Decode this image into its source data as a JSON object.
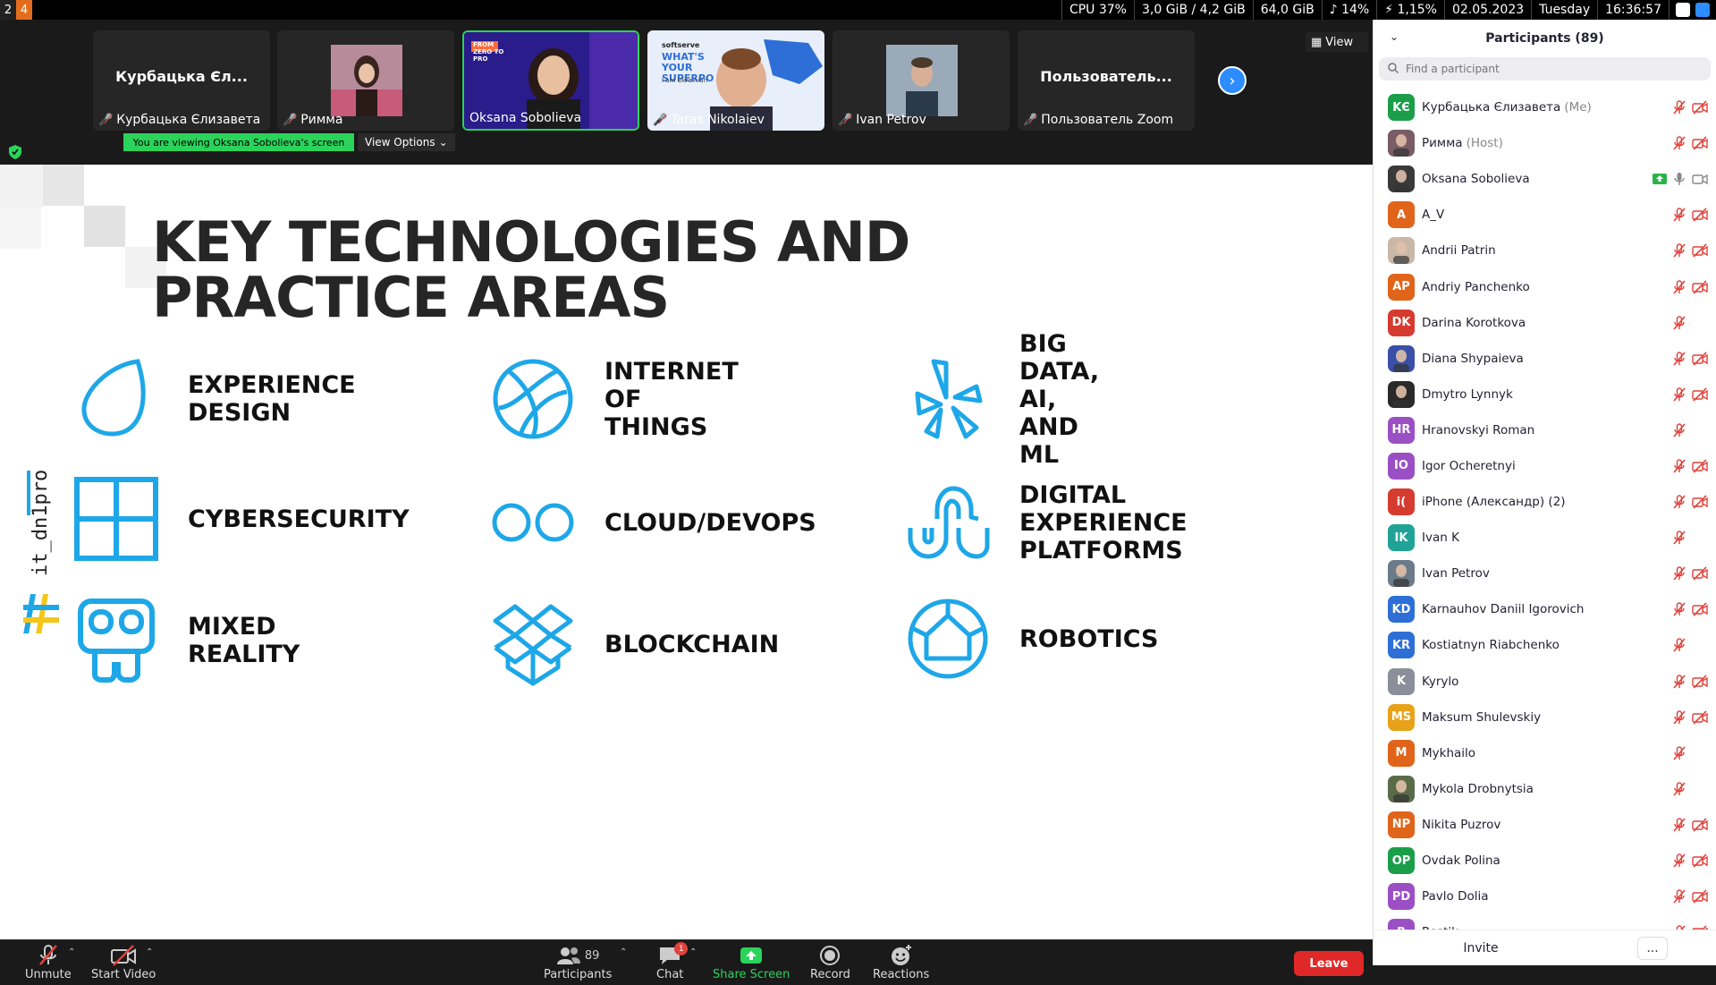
{
  "system_bar": {
    "workspaces": [
      "2",
      "4"
    ],
    "cpu": "CPU 37%",
    "mem": "3,0 GiB / 4,2 GiB",
    "disk": "64,0 GiB",
    "volume": "♪ 14%",
    "battery": "⚡ 1,15%",
    "date": "02.05.2023",
    "weekday": "Tuesday",
    "time": "16:36:57"
  },
  "thumbnails": [
    {
      "big_name": "Курбацька Єл...",
      "label": "Курбацька Єлизавета",
      "muted": true
    },
    {
      "big_name": "",
      "label": "Римма",
      "muted": true
    },
    {
      "big_name": "",
      "label": "Oksana Sobolieva",
      "muted": false,
      "active": true
    },
    {
      "big_name": "",
      "label": "Taras Nikolaiev",
      "muted": true
    },
    {
      "big_name": "",
      "label": "Ivan Petrov",
      "muted": true
    },
    {
      "big_name": "Пользователь...",
      "label": "Пользователь Zoom",
      "muted": true
    }
  ],
  "thumb_inner": {
    "oksana_slide_text": "FROM ZERO TO PRO",
    "taras_slide_text": "WHAT'S YOUR SUPERPO",
    "taras_brand": "softserve",
    "taras_sub": "I am Ukrainian"
  },
  "view_button": "View",
  "viewing_banner": "You are viewing Oksana Sobolieva's screen",
  "view_options": "View Options",
  "slide": {
    "title": "KEY TECHNOLOGIES AND PRACTICE AREAS",
    "brand": "it_dn1pro",
    "tiles": [
      {
        "label": "EXPERIENCE\nDESIGN",
        "icon": "envato-leaf-icon"
      },
      {
        "label": "INTERNET OF\nTHINGS",
        "icon": "basketball-icon"
      },
      {
        "label": "BIG DATA, AI,\nAND ML",
        "icon": "yelp-star-icon"
      },
      {
        "label": "CYBERSECURITY",
        "icon": "windows-grid-icon"
      },
      {
        "label": "CLOUD/DEVOPS",
        "icon": "flickr-dots-icon"
      },
      {
        "label": "DIGITAL\nEXPERIENCE\nPLATFORMS",
        "icon": "stumbleupon-icon"
      },
      {
        "label": "MIXED REALITY",
        "icon": "instructables-robot-icon"
      },
      {
        "label": "BLOCKCHAIN",
        "icon": "dropbox-box-icon"
      },
      {
        "label": "ROBOTICS",
        "icon": "house-circle-icon"
      }
    ],
    "accent": "#1ea7e8"
  },
  "toolbar": {
    "unmute": "Unmute",
    "start_video": "Start Video",
    "participants": "Participants",
    "participants_count": "89",
    "chat": "Chat",
    "chat_badge": "1",
    "share_screen": "Share Screen",
    "record": "Record",
    "reactions": "Reactions",
    "leave": "Leave"
  },
  "panel": {
    "title": "Participants (89)",
    "search_placeholder": "Find a participant",
    "invite": "Invite",
    "more": "...",
    "participants": [
      {
        "name": "Курбацька Єлизавета",
        "role": "(Me)",
        "initials": "KЄ",
        "color": "#1a9e4a",
        "photo": false,
        "audio": "muted",
        "video": "off"
      },
      {
        "name": "Римма",
        "role": "(Host)",
        "initials": "",
        "color": "#7a5c66",
        "photo": true,
        "audio": "muted",
        "video": "off"
      },
      {
        "name": "Oksana Sobolieva",
        "role": "",
        "initials": "",
        "color": "#3a3a3a",
        "photo": true,
        "audio": "on",
        "video": "on",
        "sharing": true
      },
      {
        "name": "A_V",
        "role": "",
        "initials": "A",
        "color": "#e0641a",
        "photo": false,
        "audio": "muted",
        "video": "off"
      },
      {
        "name": "Andrii Patrin",
        "role": "",
        "initials": "",
        "color": "#c9b8a8",
        "photo": true,
        "audio": "muted",
        "video": "off"
      },
      {
        "name": "Andriy Panchenko",
        "role": "",
        "initials": "AP",
        "color": "#e0641a",
        "photo": false,
        "audio": "muted",
        "video": "off"
      },
      {
        "name": "Darina Korotkova",
        "role": "",
        "initials": "DK",
        "color": "#d63b2f",
        "photo": false,
        "audio": "muted",
        "video": "none"
      },
      {
        "name": "Diana Shypaieva",
        "role": "",
        "initials": "",
        "color": "#3a50a8",
        "photo": true,
        "audio": "muted",
        "video": "off"
      },
      {
        "name": "Dmytro Lynnyk",
        "role": "",
        "initials": "",
        "color": "#2a2a2a",
        "photo": true,
        "audio": "muted",
        "video": "off"
      },
      {
        "name": "Hranovskyi Roman",
        "role": "",
        "initials": "HR",
        "color": "#9b4fc4",
        "photo": false,
        "audio": "muted",
        "video": "none"
      },
      {
        "name": "Igor Ocheretnyi",
        "role": "",
        "initials": "IO",
        "color": "#9b4fc4",
        "photo": false,
        "audio": "muted",
        "video": "off"
      },
      {
        "name": "iPhone (Александр) (2)",
        "role": "",
        "initials": "i(",
        "color": "#d63b2f",
        "photo": false,
        "audio": "muted",
        "video": "off"
      },
      {
        "name": "Ivan K",
        "role": "",
        "initials": "IK",
        "color": "#1fa396",
        "photo": false,
        "audio": "muted",
        "video": "none"
      },
      {
        "name": "Ivan Petrov",
        "role": "",
        "initials": "",
        "color": "#6b7b8a",
        "photo": true,
        "audio": "muted",
        "video": "off"
      },
      {
        "name": "Karnauhov Daniil Igorovich",
        "role": "",
        "initials": "KD",
        "color": "#2d6fd6",
        "photo": false,
        "audio": "muted",
        "video": "off"
      },
      {
        "name": "Kostiatnyn Riabchenko",
        "role": "",
        "initials": "KR",
        "color": "#2d6fd6",
        "photo": false,
        "audio": "muted",
        "video": "none"
      },
      {
        "name": "Kyrylo",
        "role": "",
        "initials": "K",
        "color": "#8a8f99",
        "photo": false,
        "audio": "muted",
        "video": "off"
      },
      {
        "name": "Maksum Shulevskiy",
        "role": "",
        "initials": "MS",
        "color": "#e8a21a",
        "photo": false,
        "audio": "muted",
        "video": "off"
      },
      {
        "name": "Mykhailo",
        "role": "",
        "initials": "M",
        "color": "#e0641a",
        "photo": false,
        "audio": "muted",
        "video": "none"
      },
      {
        "name": "Mykola Drobnytsia",
        "role": "",
        "initials": "",
        "color": "#5a6b4a",
        "photo": true,
        "audio": "muted",
        "video": "none"
      },
      {
        "name": "Nikita Puzrov",
        "role": "",
        "initials": "NP",
        "color": "#e0641a",
        "photo": false,
        "audio": "muted",
        "video": "off"
      },
      {
        "name": "Ovdak Polina",
        "role": "",
        "initials": "OP",
        "color": "#1a9e4a",
        "photo": false,
        "audio": "muted",
        "video": "off"
      },
      {
        "name": "Pavlo Dolia",
        "role": "",
        "initials": "PD",
        "color": "#9b4fc4",
        "photo": false,
        "audio": "muted",
        "video": "off"
      },
      {
        "name": "Rostik",
        "role": "",
        "initials": "R",
        "color": "#9b4fc4",
        "photo": false,
        "audio": "muted",
        "video": "off"
      }
    ]
  }
}
